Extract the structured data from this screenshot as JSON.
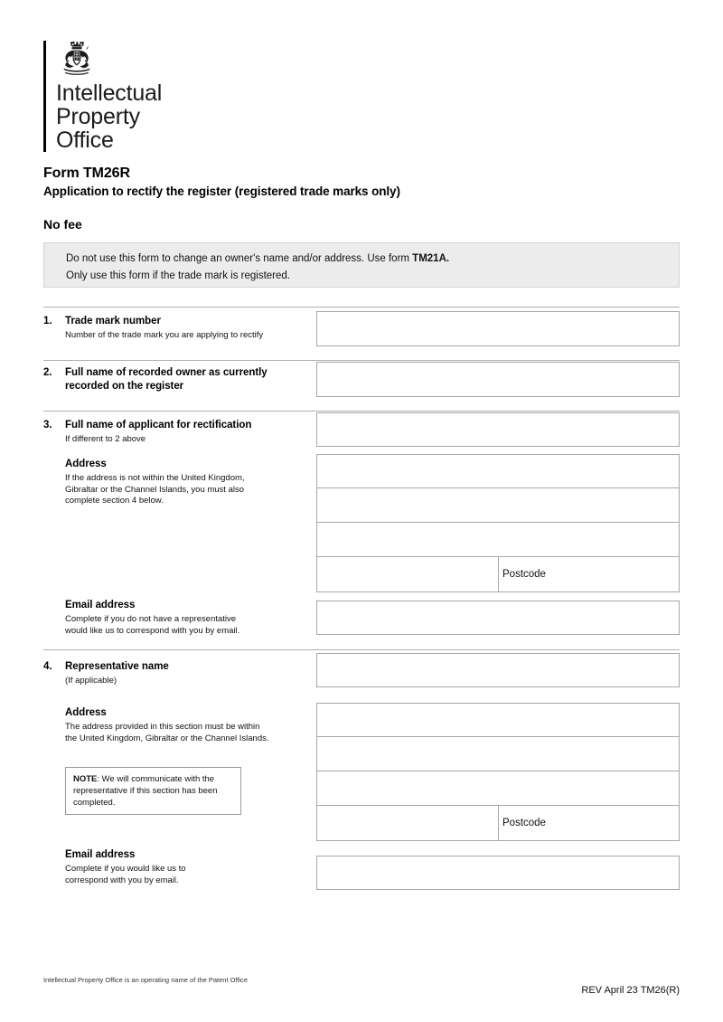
{
  "logo": {
    "crest_icon": "royal-coat-of-arms-icon",
    "line1": "Intellectual",
    "line2": "Property",
    "line3": "Office"
  },
  "header": {
    "form_title": "Form TM26R",
    "form_subtitle": "Application to rectify the register (registered trade marks only)",
    "fee": "No fee"
  },
  "notice": {
    "line1_a": "Do not use this form to change an owner's name and/or address. Use form ",
    "line1_b": "TM21A.",
    "line2": "Only use this form if the trade mark is registered."
  },
  "sections": {
    "s1": {
      "number": "1.",
      "title": "Trade mark number",
      "hint": "Number of the trade mark you are applying to rectify",
      "value": ""
    },
    "s2": {
      "number": "2.",
      "title_line1": "Full name of recorded owner as currently",
      "title_line2": "recorded on the register",
      "value": ""
    },
    "s3": {
      "number": "3.",
      "title": "Full name of applicant for rectification",
      "hint": "If different to 2 above",
      "value": "",
      "address": {
        "title": "Address",
        "hint_line1": "If the address is not within the United Kingdom,",
        "hint_line2": "Gibraltar or the Channel Islands, you must also",
        "hint_line3": "complete section 4 below.",
        "line1": "",
        "line2": "",
        "line3": "",
        "town": "",
        "postcode_label": "Postcode",
        "postcode": ""
      },
      "email": {
        "title": "Email address",
        "hint_line1": "Complete if you do not have a representative",
        "hint_line2": "would like us to correspond with you by email.",
        "value": ""
      }
    },
    "s4": {
      "number": "4.",
      "title": "Representative name",
      "hint": "(If applicable)",
      "value": "",
      "address": {
        "title": "Address",
        "hint_line1": "The address provided in this section must be within",
        "hint_line2": "the United Kingdom, Gibraltar or the Channel Islands.",
        "line1": "",
        "line2": "",
        "line3": "",
        "town": "",
        "postcode_label": "Postcode",
        "postcode": ""
      },
      "note": {
        "bold": "NOTE",
        "rest": ":  We will communicate with the representative if this section has been completed."
      },
      "email": {
        "title": "Email address",
        "hint_line1": "Complete if you would like us to",
        "hint_line2": "correspond with you by email.",
        "value": ""
      }
    }
  },
  "footer": {
    "left": "Intellectual Property Office is an operating name of the Patent Office",
    "right": "REV April 23 TM26(R)"
  },
  "colors": {
    "notice_bg": "#ececec",
    "field_border": "#a8a8a8",
    "rule": "#b0b0b0"
  }
}
